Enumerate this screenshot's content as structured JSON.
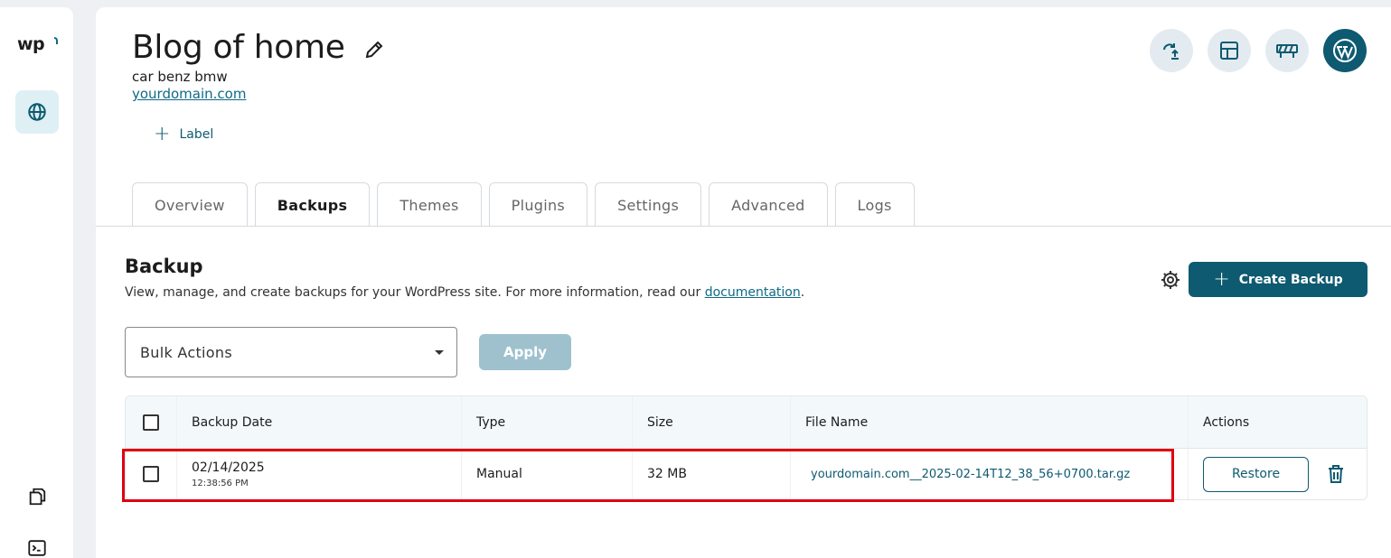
{
  "sidebar": {
    "logo": "wp"
  },
  "header": {
    "title": "Blog of home",
    "description": "car benz bmw",
    "domain": "yourdomain.com",
    "add_label": "Label"
  },
  "tabs": [
    {
      "label": "Overview"
    },
    {
      "label": "Backups"
    },
    {
      "label": "Themes"
    },
    {
      "label": "Plugins"
    },
    {
      "label": "Settings"
    },
    {
      "label": "Advanced"
    },
    {
      "label": "Logs"
    }
  ],
  "active_tab": "Backups",
  "backup": {
    "title": "Backup",
    "description_prefix": "View, manage, and create backups for your WordPress site. For more information, read our ",
    "description_link": "documentation",
    "description_suffix": ".",
    "create_label": "Create Backup",
    "bulk_actions": "Bulk Actions",
    "apply_label": "Apply"
  },
  "table": {
    "columns": [
      "Backup Date",
      "Type",
      "Size",
      "File Name",
      "Actions"
    ],
    "rows": [
      {
        "date": "02/14/2025",
        "time": "12:38:56 PM",
        "type": "Manual",
        "size": "32 MB",
        "file_name": "yourdomain.com__2025-02-14T12_38_56+0700.tar.gz",
        "action": "Restore"
      }
    ]
  },
  "colors": {
    "primary": "#0e5a70",
    "link": "#0e6a86",
    "highlight": "#e0000f",
    "apply_disabled": "#9ec1cd"
  }
}
